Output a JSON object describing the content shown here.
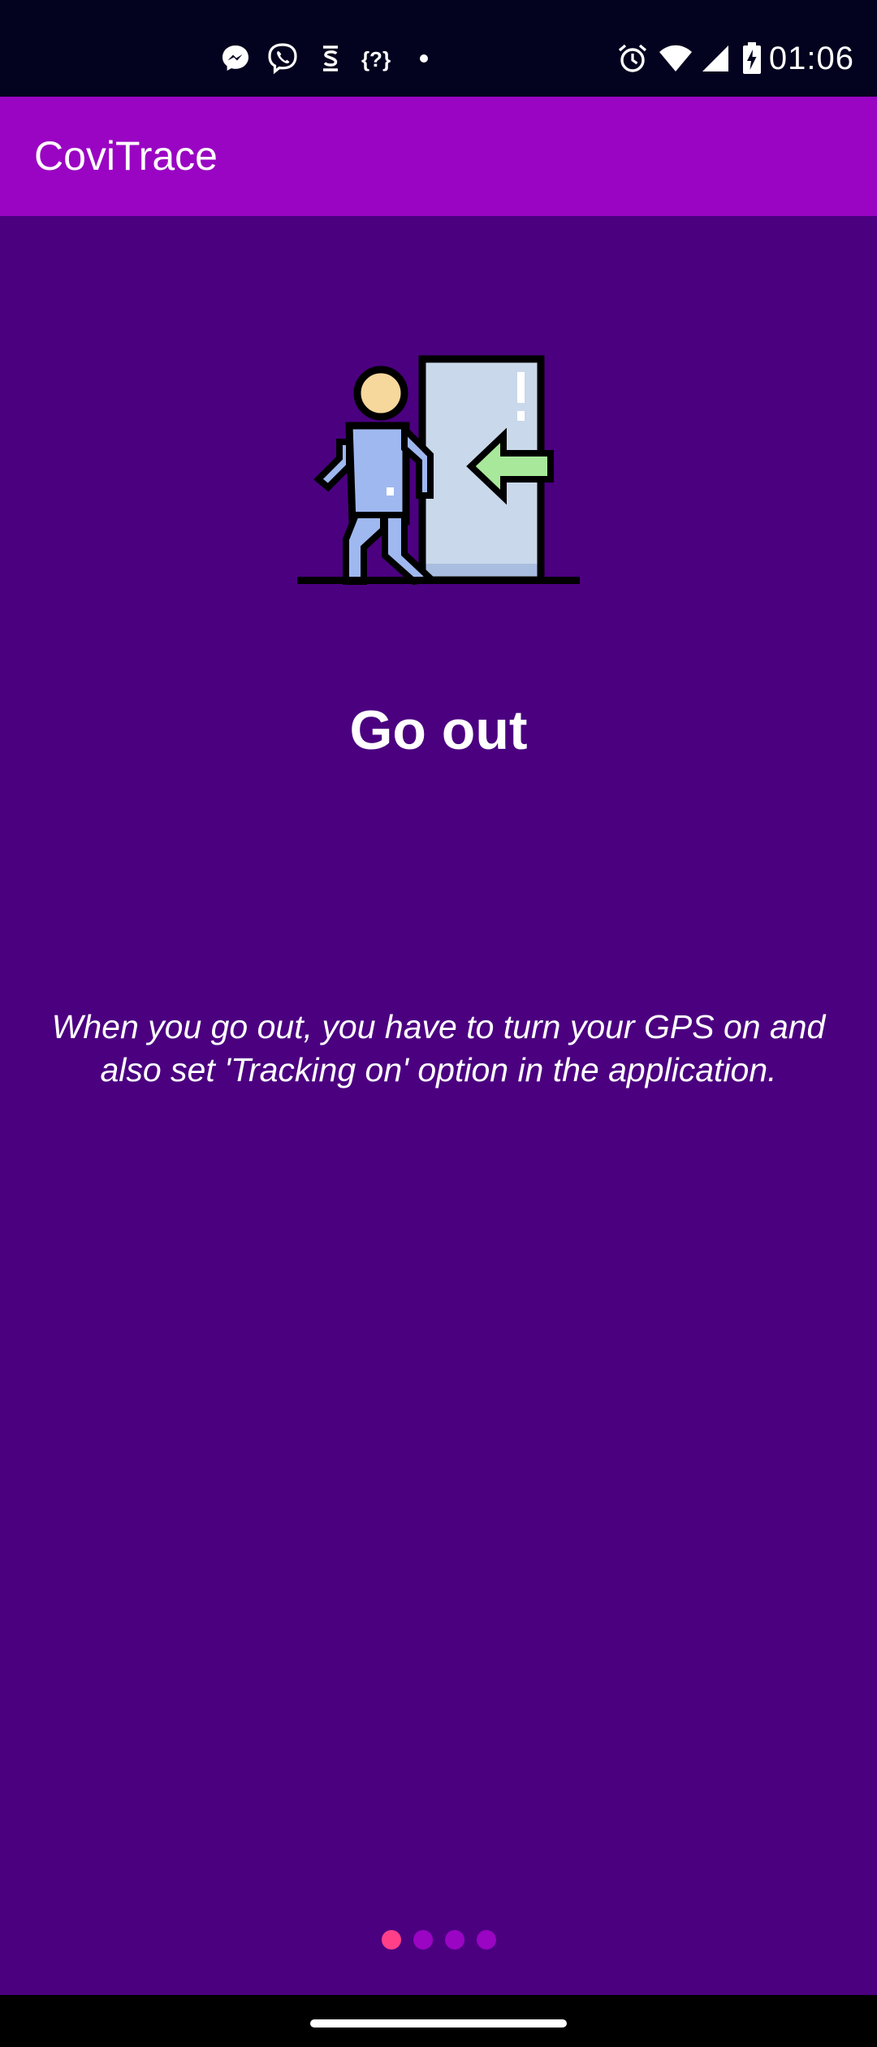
{
  "status_bar": {
    "time": "01:06",
    "notification_icons": [
      "messenger-icon",
      "viber-icon",
      "sim-toolkit-icon",
      "code-icon",
      "more-dot-icon"
    ],
    "system_icons": [
      "alarm-icon",
      "wifi-icon",
      "signal-icon",
      "battery-charging-icon"
    ]
  },
  "app_bar": {
    "title": "CoviTrace"
  },
  "onboarding": {
    "illustration": "person-exit-door-icon",
    "heading": "Go out",
    "description": "When you go out, you have to turn your GPS on and also set 'Tracking on' option in the application.",
    "total_pages": 4,
    "current_page": 1
  },
  "colors": {
    "status_bar": "#03021f",
    "app_bar": "#9a04c3",
    "background": "#4b0080",
    "dot_active": "#ff3f88",
    "dot_inactive": "#9a04c3"
  }
}
